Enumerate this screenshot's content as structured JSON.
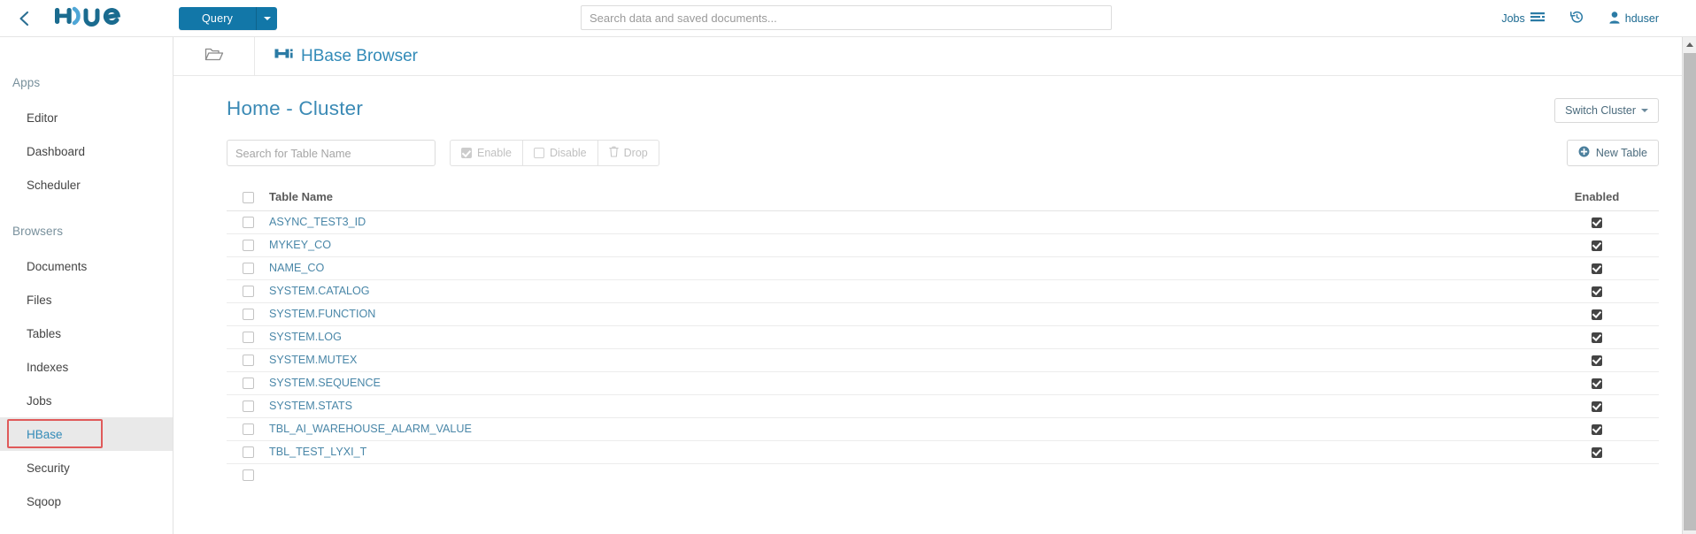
{
  "topbar": {
    "back_icon": "chevron-left-icon",
    "logo_text": "hue",
    "query_label": "Query",
    "query_caret_icon": "caret-down-icon",
    "search_placeholder": "Search data and saved documents...",
    "search_value": "",
    "jobs_label": "Jobs",
    "jobs_icon": "jobs-list-icon",
    "history_icon": "history-rewind-icon",
    "user_label": "hduser",
    "user_icon": "user-icon",
    "accent_color": "#1277a8"
  },
  "sidebar": {
    "sections": [
      {
        "title": "Apps",
        "items": [
          {
            "label": "Editor",
            "active": false
          },
          {
            "label": "Dashboard",
            "active": false
          },
          {
            "label": "Scheduler",
            "active": false
          }
        ]
      },
      {
        "title": "Browsers",
        "items": [
          {
            "label": "Documents",
            "active": false
          },
          {
            "label": "Files",
            "active": false
          },
          {
            "label": "Tables",
            "active": false
          },
          {
            "label": "Indexes",
            "active": false
          },
          {
            "label": "Jobs",
            "active": false
          },
          {
            "label": "HBase",
            "active": true
          },
          {
            "label": "Security",
            "active": false
          },
          {
            "label": "Sqoop",
            "active": false
          }
        ]
      }
    ],
    "highlight_color": "#e05a5a",
    "active_bg": "#e9e9e9"
  },
  "app_header": {
    "assist_icon": "folder-icon",
    "hbase_icon": "hbase-logo-icon",
    "title": "HBase Browser"
  },
  "page": {
    "heading": "Home - Cluster",
    "switch_cluster_label": "Switch Cluster",
    "switch_cluster_caret_icon": "caret-down-icon"
  },
  "toolbar": {
    "search_placeholder": "Search for Table Name",
    "search_value": "",
    "enable_label": "Enable",
    "enable_icon": "checkbox-checked-icon",
    "disable_label": "Disable",
    "disable_icon": "checkbox-empty-icon",
    "drop_label": "Drop",
    "drop_icon": "trash-icon",
    "new_table_label": "New Table",
    "new_table_icon": "plus-circle-icon"
  },
  "table": {
    "columns": [
      "",
      "Table Name",
      "Enabled"
    ],
    "select_all_checked": false,
    "rows": [
      {
        "name": "ASYNC_TEST3_ID",
        "selected": false,
        "enabled": true
      },
      {
        "name": "MYKEY_CO",
        "selected": false,
        "enabled": true
      },
      {
        "name": "NAME_CO",
        "selected": false,
        "enabled": true
      },
      {
        "name": "SYSTEM.CATALOG",
        "selected": false,
        "enabled": true
      },
      {
        "name": "SYSTEM.FUNCTION",
        "selected": false,
        "enabled": true
      },
      {
        "name": "SYSTEM.LOG",
        "selected": false,
        "enabled": true
      },
      {
        "name": "SYSTEM.MUTEX",
        "selected": false,
        "enabled": true
      },
      {
        "name": "SYSTEM.SEQUENCE",
        "selected": false,
        "enabled": true
      },
      {
        "name": "SYSTEM.STATS",
        "selected": false,
        "enabled": true
      },
      {
        "name": "TBL_AI_WAREHOUSE_ALARM_VALUE",
        "selected": false,
        "enabled": true
      },
      {
        "name": "TBL_TEST_LYXI_T",
        "selected": false,
        "enabled": true
      },
      {
        "name": "",
        "selected": false,
        "enabled": false
      }
    ]
  },
  "scrollbar": {
    "up_arrow_icon": "triangle-up-icon",
    "position": "top"
  }
}
